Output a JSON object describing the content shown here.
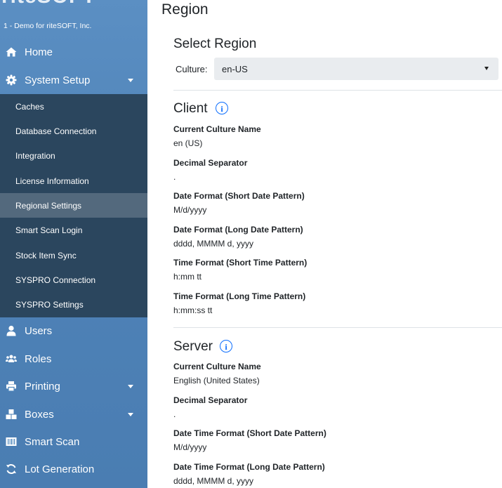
{
  "sidebar": {
    "logo": "riteSOFT",
    "company": "1 - Demo for riteSOFT, Inc.",
    "items": [
      {
        "label": "Home",
        "icon": "home-icon"
      },
      {
        "label": "System Setup",
        "icon": "gear-icon"
      },
      {
        "label": "Users",
        "icon": "user-icon"
      },
      {
        "label": "Roles",
        "icon": "users-icon"
      },
      {
        "label": "Printing",
        "icon": "printer-icon"
      },
      {
        "label": "Boxes",
        "icon": "boxes-icon"
      },
      {
        "label": "Smart Scan",
        "icon": "barcode-icon"
      },
      {
        "label": "Lot Generation",
        "icon": "sync-icon"
      }
    ],
    "system_setup_children": [
      "Caches",
      "Database Connection",
      "Integration",
      "License Information",
      "Regional Settings",
      "Smart Scan Login",
      "Stock Item Sync",
      "SYSPRO Connection",
      "SYSPRO Settings"
    ],
    "active_child": "Regional Settings"
  },
  "main": {
    "title": "Region",
    "select_region": {
      "heading": "Select Region",
      "culture_label": "Culture:",
      "culture_value": "en-US"
    },
    "client": {
      "heading": "Client",
      "fields": [
        {
          "label": "Current Culture Name",
          "value": "en (US)"
        },
        {
          "label": "Decimal Separator",
          "value": "."
        },
        {
          "label": "Date Format (Short Date Pattern)",
          "value": "M/d/yyyy"
        },
        {
          "label": "Date Format (Long Date Pattern)",
          "value": "dddd, MMMM d, yyyy"
        },
        {
          "label": "Time Format (Short Time Pattern)",
          "value": "h:mm tt"
        },
        {
          "label": "Time Format (Long Time Pattern)",
          "value": "h:mm:ss tt"
        }
      ]
    },
    "server": {
      "heading": "Server",
      "fields": [
        {
          "label": "Current Culture Name",
          "value": "English (United States)"
        },
        {
          "label": "Decimal Separator",
          "value": "."
        },
        {
          "label": "Date Time Format (Short Date Pattern)",
          "value": "M/d/yyyy"
        },
        {
          "label": "Date Time Format (Long Date Pattern)",
          "value": "dddd, MMMM d, yyyy"
        }
      ]
    }
  },
  "colors": {
    "sidebar": "#5088bd",
    "submenu": "#2b465e",
    "submenu_active": "#53697d",
    "info": "#0d6efd"
  }
}
